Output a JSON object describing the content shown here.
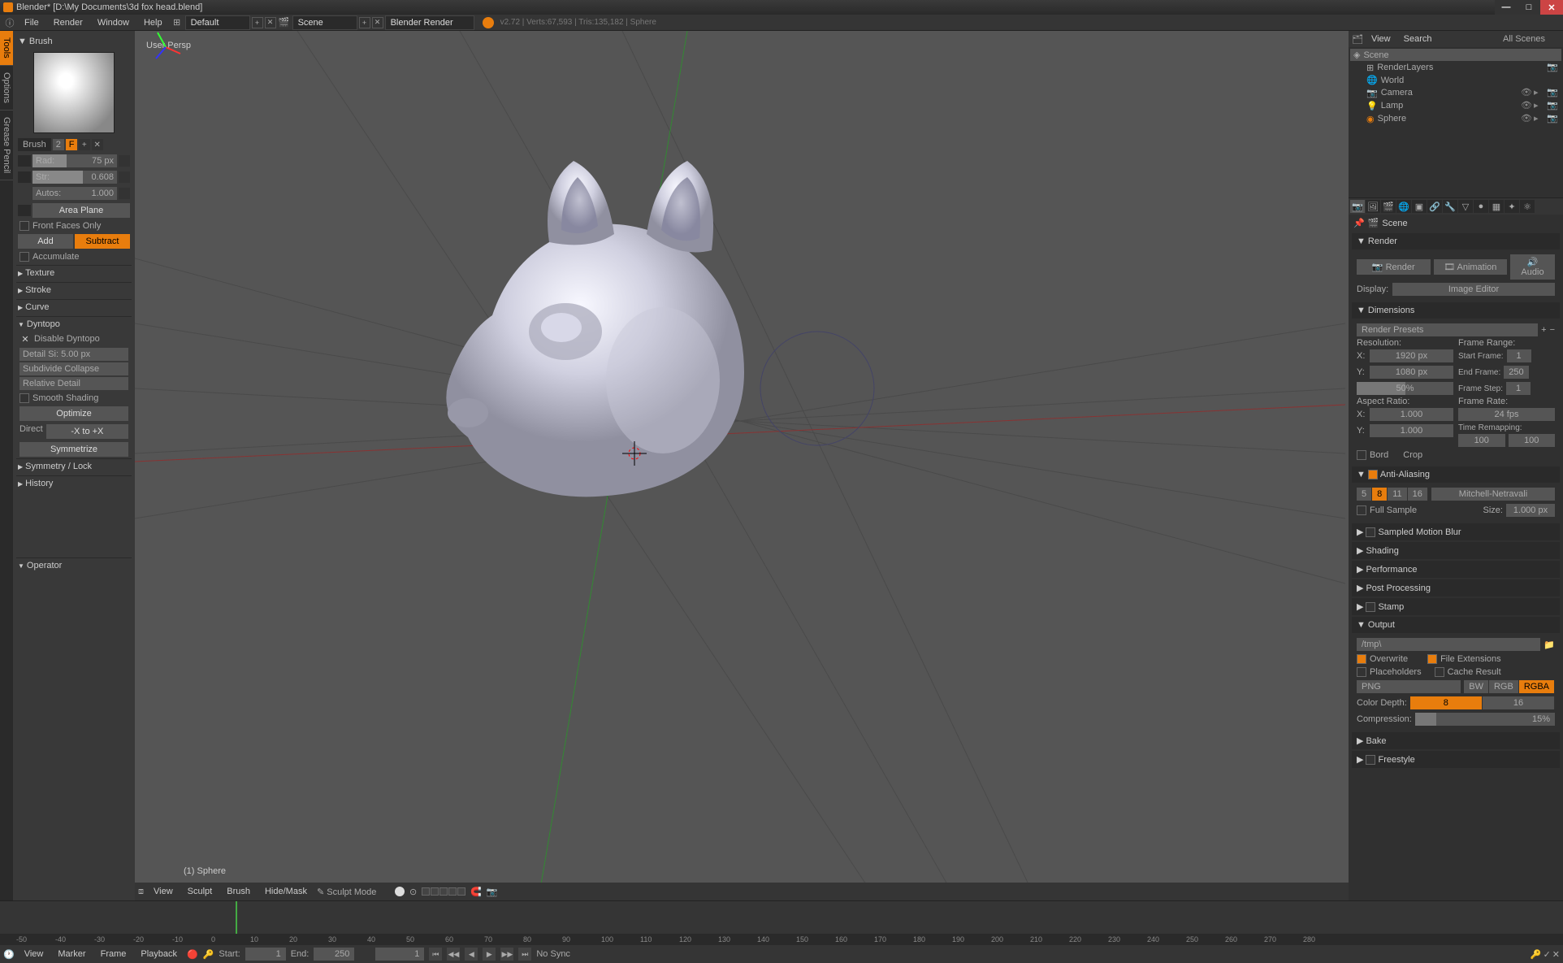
{
  "titlebar": {
    "title": "Blender* [D:\\My Documents\\3d fox head.blend]"
  },
  "topbar": {
    "file": "File",
    "render": "Render",
    "window": "Window",
    "help": "Help",
    "layout": "Default",
    "scene": "Scene",
    "engine": "Blender Render",
    "stats": "v2.72 | Verts:67,593 | Tris:135,182 | Sphere"
  },
  "leftTabs": {
    "tools": "Tools",
    "options": "Options",
    "grease": "Grease Pencil"
  },
  "toolPanel": {
    "brushTitle": "Brush",
    "brushName": "Brush",
    "frame": "2",
    "f": "F",
    "radiusLabel": "Rad:",
    "radiusVal": "75 px",
    "strengthLabel": "Str:",
    "strengthVal": "0.608",
    "autosLabel": "Autos:",
    "autosVal": "1.000",
    "areaPlane": "Area Plane",
    "frontFaces": "Front Faces Only",
    "add": "Add",
    "subtract": "Subtract",
    "accumulate": "Accumulate",
    "texture": "Texture",
    "stroke": "Stroke",
    "curve": "Curve",
    "dyntopo": "Dyntopo",
    "disableDyntopo": "Disable Dyntopo",
    "detailSize": "Detail Si: 5.00 px",
    "subdivCollapse": "Subdivide Collapse",
    "relativeDetail": "Relative Detail",
    "smoothShading": "Smooth Shading",
    "optimize": "Optimize",
    "direction": "Direct",
    "directVal": "-X to +X",
    "symmetrize": "Symmetrize",
    "symmetryLock": "Symmetry / Lock",
    "history": "History",
    "operator": "Operator"
  },
  "viewport": {
    "perspLabel": "User Persp",
    "objLabel": "(1) Sphere",
    "view": "View",
    "sculpt": "Sculpt",
    "brush": "Brush",
    "hideMask": "Hide/Mask",
    "mode": "Sculpt Mode"
  },
  "outlinerHeader": {
    "view": "View",
    "search": "Search",
    "allScenes": "All Scenes"
  },
  "outliner": {
    "scene": "Scene",
    "renderLayers": "RenderLayers",
    "world": "World",
    "camera": "Camera",
    "lamp": "Lamp",
    "sphere": "Sphere"
  },
  "properties": {
    "breadcrumb": "Scene",
    "renderPanel": "Render",
    "renderBtn": "Render",
    "animationBtn": "Animation",
    "audioBtn": "Audio",
    "displayLabel": "Display:",
    "displayVal": "Image Editor",
    "dimensions": "Dimensions",
    "renderPresets": "Render Presets",
    "resolution": "Resolution:",
    "resX": "X:",
    "resXVal": "1920 px",
    "resY": "Y:",
    "resYVal": "1080 px",
    "resPct": "50%",
    "frameRange": "Frame Range:",
    "startFrame": "Start Frame:",
    "startFrameVal": "1",
    "endFrame": "End Frame:",
    "endFrameVal": "250",
    "frameStep": "Frame Step:",
    "frameStepVal": "1",
    "aspectRatio": "Aspect Ratio:",
    "aspectX": "X:",
    "aspectXVal": "1.000",
    "aspectY": "Y:",
    "aspectYVal": "1.000",
    "frameRate": "Frame Rate:",
    "frameRateVal": "24 fps",
    "timeRemapping": "Time Remapping:",
    "timeRemapOld": "100",
    "timeRemapNew": "100",
    "border": "Bord",
    "crop": "Crop",
    "antiAliasing": "Anti-Aliasing",
    "aa5": "5",
    "aa8": "8",
    "aa11": "11",
    "aa16": "16",
    "aaFilter": "Mitchell-Netravali",
    "fullSample": "Full Sample",
    "sizeLabel": "Size:",
    "sizeVal": "1.000 px",
    "sampledMotionBlur": "Sampled Motion Blur",
    "shading": "Shading",
    "performance": "Performance",
    "postProcessing": "Post Processing",
    "stamp": "Stamp",
    "output": "Output",
    "outputPath": "/tmp\\",
    "overwrite": "Overwrite",
    "fileExt": "File Extensions",
    "placeholders": "Placeholders",
    "cacheResult": "Cache Result",
    "format": "PNG",
    "bw": "BW",
    "rgb": "RGB",
    "rgba": "RGBA",
    "colorDepth": "Color Depth:",
    "depth8": "8",
    "depth16": "16",
    "compression": "Compression:",
    "compressionVal": "15%",
    "bake": "Bake",
    "freestyle": "Freestyle"
  },
  "timeline": {
    "ticks": [
      "-50",
      "-40",
      "-30",
      "-20",
      "-10",
      "0",
      "10",
      "20",
      "30",
      "40",
      "50",
      "60",
      "70",
      "80",
      "90",
      "100",
      "110",
      "120",
      "130",
      "140",
      "150",
      "160",
      "170",
      "180",
      "190",
      "200",
      "210",
      "220",
      "230",
      "240",
      "250",
      "260",
      "270",
      "280"
    ],
    "view": "View",
    "marker": "Marker",
    "frame": "Frame",
    "playback": "Playback",
    "startLabel": "Start:",
    "startVal": "1",
    "endLabel": "End:",
    "endVal": "250",
    "curFrame": "1",
    "noSync": "No Sync"
  }
}
